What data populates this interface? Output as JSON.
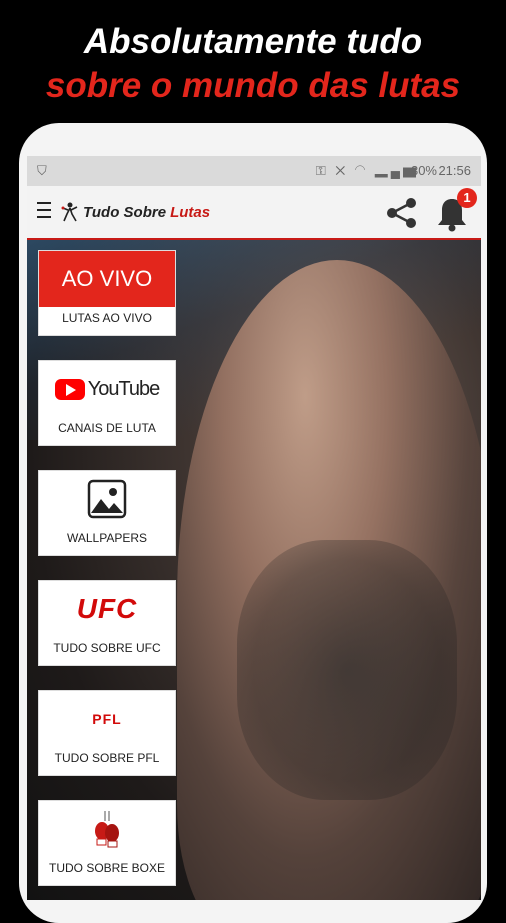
{
  "headline": {
    "line1": "Absolutamente tudo",
    "line2": "sobre o mundo das lutas"
  },
  "statusbar": {
    "battery": "30%",
    "time": "21:56"
  },
  "appbar": {
    "logo_part1": "Tudo Sobre",
    "logo_part2": "Lutas",
    "notification_count": "1"
  },
  "tiles": [
    {
      "header": "AO VIVO",
      "label": "LUTAS AO VIVO",
      "icon": "live-banner"
    },
    {
      "header": "YouTube",
      "label": "CANAIS DE LUTA",
      "icon": "youtube-logo"
    },
    {
      "header": "",
      "label": "WALLPAPERS",
      "icon": "image-icon"
    },
    {
      "header": "UFC",
      "label": "TUDO SOBRE UFC",
      "icon": "ufc-logo"
    },
    {
      "header": "PFL",
      "label": "TUDO SOBRE PFL",
      "icon": "pfl-logo"
    },
    {
      "header": "",
      "label": "TUDO SOBRE BOXE",
      "icon": "boxing-gloves-icon"
    }
  ],
  "colors": {
    "accent": "#e3261c",
    "appbar_bg": "#f3f3f3",
    "background": "#000000"
  }
}
